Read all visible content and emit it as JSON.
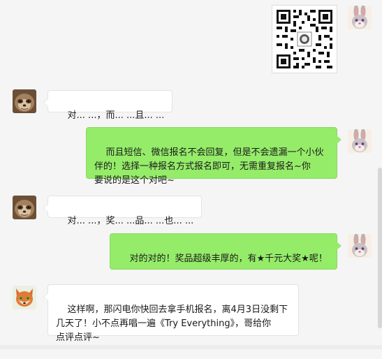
{
  "messages": [
    {
      "sender": "bunny",
      "type": "image",
      "image": "qr-code"
    },
    {
      "sender": "sloth",
      "type": "text",
      "text": "对... ...，而... ...且... ..."
    },
    {
      "sender": "bunny",
      "type": "text",
      "text": "而且短信、微信报名不会回复，但是不会遗漏一个小伙\n伴的！选择一种报名方式报名即可，无需重复报名~你\n要说的是这个对吧~"
    },
    {
      "sender": "sloth",
      "type": "text",
      "text": "对... ...，奖... ...品... ...也... ..."
    },
    {
      "sender": "bunny",
      "type": "text",
      "text": "对的对的！奖品超级丰厚的，有★千元大奖★呢！"
    },
    {
      "sender": "fox",
      "type": "text",
      "text": "这样啊，那闪电你快回去拿手机报名，离4月3日没剩下\n几天了！小不点再唱一遍《Try Everything》，哥给你\n点评点评~"
    }
  ],
  "colors": {
    "right_bubble": "#95ec69",
    "left_bubble": "#ffffff",
    "background": "#f5f5f5"
  },
  "icons": [
    "bunny-avatar-icon",
    "sloth-avatar-icon",
    "fox-avatar-icon",
    "qr-code-icon"
  ]
}
